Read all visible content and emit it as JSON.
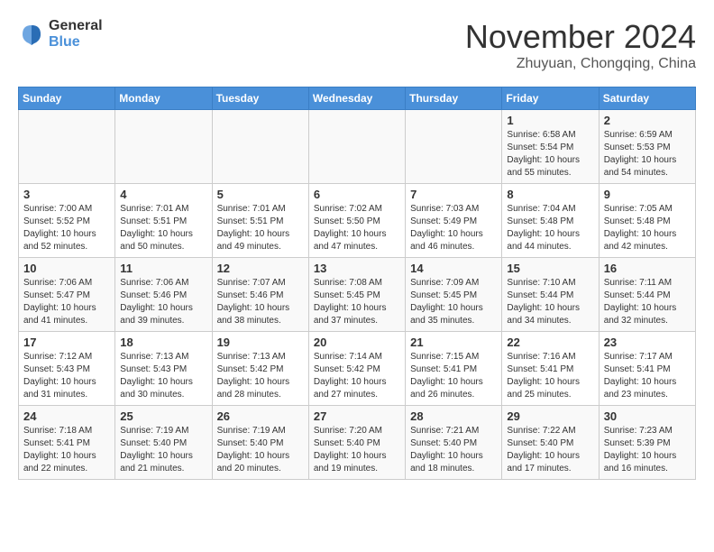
{
  "header": {
    "logo_general": "General",
    "logo_blue": "Blue",
    "month": "November 2024",
    "location": "Zhuyuan, Chongqing, China"
  },
  "weekdays": [
    "Sunday",
    "Monday",
    "Tuesday",
    "Wednesday",
    "Thursday",
    "Friday",
    "Saturday"
  ],
  "weeks": [
    [
      {
        "day": "",
        "info": ""
      },
      {
        "day": "",
        "info": ""
      },
      {
        "day": "",
        "info": ""
      },
      {
        "day": "",
        "info": ""
      },
      {
        "day": "",
        "info": ""
      },
      {
        "day": "1",
        "info": "Sunrise: 6:58 AM\nSunset: 5:54 PM\nDaylight: 10 hours and 55 minutes."
      },
      {
        "day": "2",
        "info": "Sunrise: 6:59 AM\nSunset: 5:53 PM\nDaylight: 10 hours and 54 minutes."
      }
    ],
    [
      {
        "day": "3",
        "info": "Sunrise: 7:00 AM\nSunset: 5:52 PM\nDaylight: 10 hours and 52 minutes."
      },
      {
        "day": "4",
        "info": "Sunrise: 7:01 AM\nSunset: 5:51 PM\nDaylight: 10 hours and 50 minutes."
      },
      {
        "day": "5",
        "info": "Sunrise: 7:01 AM\nSunset: 5:51 PM\nDaylight: 10 hours and 49 minutes."
      },
      {
        "day": "6",
        "info": "Sunrise: 7:02 AM\nSunset: 5:50 PM\nDaylight: 10 hours and 47 minutes."
      },
      {
        "day": "7",
        "info": "Sunrise: 7:03 AM\nSunset: 5:49 PM\nDaylight: 10 hours and 46 minutes."
      },
      {
        "day": "8",
        "info": "Sunrise: 7:04 AM\nSunset: 5:48 PM\nDaylight: 10 hours and 44 minutes."
      },
      {
        "day": "9",
        "info": "Sunrise: 7:05 AM\nSunset: 5:48 PM\nDaylight: 10 hours and 42 minutes."
      }
    ],
    [
      {
        "day": "10",
        "info": "Sunrise: 7:06 AM\nSunset: 5:47 PM\nDaylight: 10 hours and 41 minutes."
      },
      {
        "day": "11",
        "info": "Sunrise: 7:06 AM\nSunset: 5:46 PM\nDaylight: 10 hours and 39 minutes."
      },
      {
        "day": "12",
        "info": "Sunrise: 7:07 AM\nSunset: 5:46 PM\nDaylight: 10 hours and 38 minutes."
      },
      {
        "day": "13",
        "info": "Sunrise: 7:08 AM\nSunset: 5:45 PM\nDaylight: 10 hours and 37 minutes."
      },
      {
        "day": "14",
        "info": "Sunrise: 7:09 AM\nSunset: 5:45 PM\nDaylight: 10 hours and 35 minutes."
      },
      {
        "day": "15",
        "info": "Sunrise: 7:10 AM\nSunset: 5:44 PM\nDaylight: 10 hours and 34 minutes."
      },
      {
        "day": "16",
        "info": "Sunrise: 7:11 AM\nSunset: 5:44 PM\nDaylight: 10 hours and 32 minutes."
      }
    ],
    [
      {
        "day": "17",
        "info": "Sunrise: 7:12 AM\nSunset: 5:43 PM\nDaylight: 10 hours and 31 minutes."
      },
      {
        "day": "18",
        "info": "Sunrise: 7:13 AM\nSunset: 5:43 PM\nDaylight: 10 hours and 30 minutes."
      },
      {
        "day": "19",
        "info": "Sunrise: 7:13 AM\nSunset: 5:42 PM\nDaylight: 10 hours and 28 minutes."
      },
      {
        "day": "20",
        "info": "Sunrise: 7:14 AM\nSunset: 5:42 PM\nDaylight: 10 hours and 27 minutes."
      },
      {
        "day": "21",
        "info": "Sunrise: 7:15 AM\nSunset: 5:41 PM\nDaylight: 10 hours and 26 minutes."
      },
      {
        "day": "22",
        "info": "Sunrise: 7:16 AM\nSunset: 5:41 PM\nDaylight: 10 hours and 25 minutes."
      },
      {
        "day": "23",
        "info": "Sunrise: 7:17 AM\nSunset: 5:41 PM\nDaylight: 10 hours and 23 minutes."
      }
    ],
    [
      {
        "day": "24",
        "info": "Sunrise: 7:18 AM\nSunset: 5:41 PM\nDaylight: 10 hours and 22 minutes."
      },
      {
        "day": "25",
        "info": "Sunrise: 7:19 AM\nSunset: 5:40 PM\nDaylight: 10 hours and 21 minutes."
      },
      {
        "day": "26",
        "info": "Sunrise: 7:19 AM\nSunset: 5:40 PM\nDaylight: 10 hours and 20 minutes."
      },
      {
        "day": "27",
        "info": "Sunrise: 7:20 AM\nSunset: 5:40 PM\nDaylight: 10 hours and 19 minutes."
      },
      {
        "day": "28",
        "info": "Sunrise: 7:21 AM\nSunset: 5:40 PM\nDaylight: 10 hours and 18 minutes."
      },
      {
        "day": "29",
        "info": "Sunrise: 7:22 AM\nSunset: 5:40 PM\nDaylight: 10 hours and 17 minutes."
      },
      {
        "day": "30",
        "info": "Sunrise: 7:23 AM\nSunset: 5:39 PM\nDaylight: 10 hours and 16 minutes."
      }
    ]
  ]
}
